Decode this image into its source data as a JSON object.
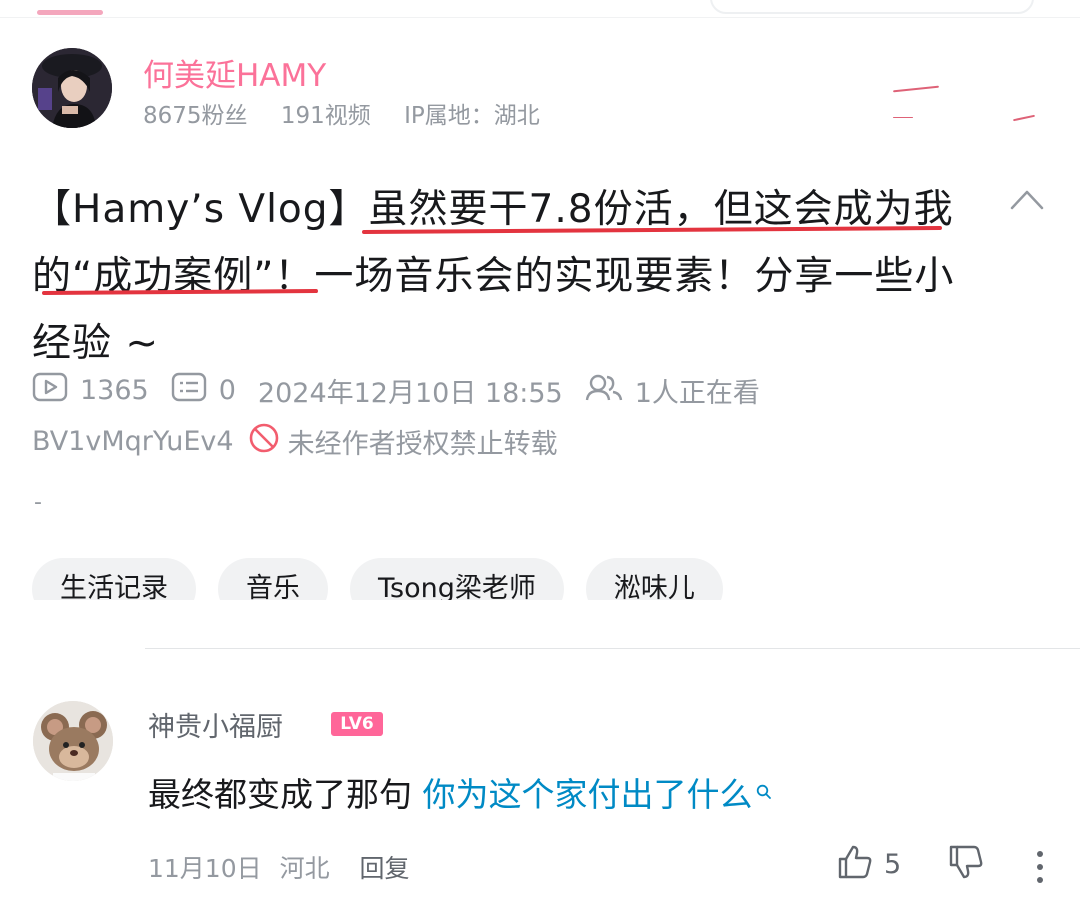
{
  "uploader": {
    "name": "何美延HAMY",
    "fans": "8675粉丝",
    "videos": "191视频",
    "ip": "IP属地：湖北"
  },
  "video": {
    "title": "【Hamy’s Vlog】虽然要干7.8份活，但这会成为我的“成功案例”！一场音乐会的实现要素！分享一些小经验 ~",
    "plays": "1365",
    "danmaku": "0",
    "datetime": "2024年12月10日 18:55",
    "watching": "1人正在看",
    "bvid": "BV1vMqrYuEv4",
    "copyright": "未经作者授权禁止转载",
    "description": "-",
    "tags": [
      "生活记录",
      "音乐",
      "Tsong梁老师",
      "淞味儿"
    ]
  },
  "comment": {
    "user": "神贵小福厨",
    "level": "LV6",
    "text": "最终都变成了那句 ",
    "link_text": "你为这个家付出了什么",
    "date": "11月10日",
    "location": "河北",
    "reply_label": "回复",
    "likes": "5"
  },
  "colors": {
    "accent_pink": "#fb7299",
    "link_blue": "#008ac5",
    "muted_text": "#9499a0",
    "annotation_red": "#e3343f"
  },
  "icons": {
    "play": "play-count-icon",
    "danmaku": "danmaku-icon",
    "watching": "watching-people-icon",
    "no_repost": "no-repost-icon",
    "collapse": "chevron-up-icon",
    "like": "thumbs-up-icon",
    "dislike": "thumbs-down-icon",
    "more": "more-vertical-icon",
    "search": "search-icon"
  }
}
